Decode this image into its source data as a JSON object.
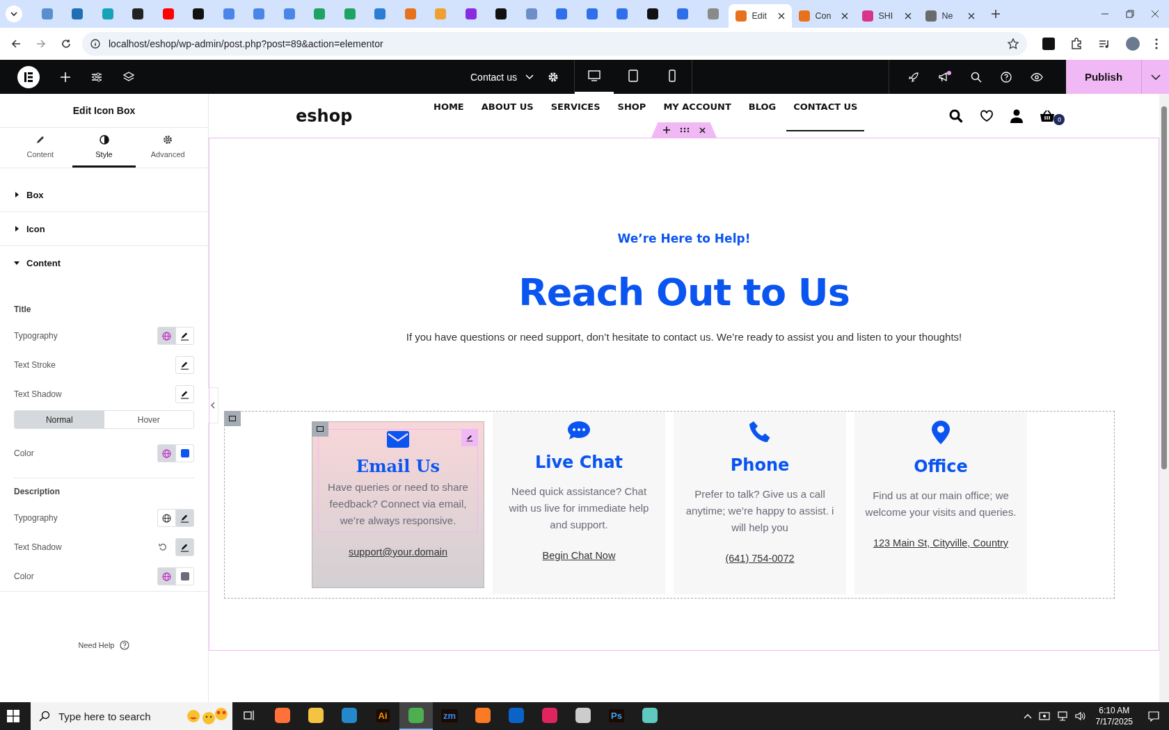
{
  "browser": {
    "favicon_tabs": [
      {
        "color": "#5a8ed1"
      },
      {
        "color": "#1f6fb5"
      },
      {
        "color": "#16a3b8"
      },
      {
        "color": "#222222"
      },
      {
        "color": "#ff0000"
      },
      {
        "color": "#111111"
      },
      {
        "color": "#4a86e8"
      },
      {
        "color": "#4a86e8"
      },
      {
        "color": "#4a86e8"
      },
      {
        "color": "#1ea362"
      },
      {
        "color": "#1ea362"
      },
      {
        "color": "#2b7cd3"
      },
      {
        "color": "#e8721c"
      },
      {
        "color": "#f0a030"
      },
      {
        "color": "#8a2be2"
      },
      {
        "color": "#111111"
      },
      {
        "color": "#6d8fc7"
      },
      {
        "color": "#2f6fea"
      },
      {
        "color": "#2f6fea"
      },
      {
        "color": "#2f6fea"
      },
      {
        "color": "#111111"
      },
      {
        "color": "#2f6fea"
      },
      {
        "color": "#8a8a8a"
      }
    ],
    "tabs": [
      {
        "label": "Edit",
        "selected": true,
        "color": "#e8721c"
      },
      {
        "label": "Con",
        "selected": false,
        "color": "#e8721c"
      },
      {
        "label": "SHI",
        "selected": false,
        "color": "#d9338a"
      },
      {
        "label": "Ne",
        "selected": false,
        "color": "#6b6b6b"
      }
    ],
    "url": "localhost/eshop/wp-admin/post.php?post=89&action=elementor"
  },
  "editor_bar": {
    "page_title": "Contact us",
    "devices": [
      {
        "kind": "desktop",
        "selected": true
      },
      {
        "kind": "tablet",
        "selected": false
      },
      {
        "kind": "mobile",
        "selected": false
      }
    ],
    "publish": "Publish"
  },
  "panel": {
    "title": "Edit Icon Box",
    "tabs": [
      {
        "label": "Content",
        "kind": "pencil",
        "selected": false
      },
      {
        "label": "Style",
        "kind": "contrast",
        "selected": true
      },
      {
        "label": "Advanced",
        "kind": "gear",
        "selected": false
      }
    ],
    "sections": [
      {
        "label": "Box",
        "expanded": false
      },
      {
        "label": "Icon",
        "expanded": false
      },
      {
        "label": "Content",
        "expanded": true,
        "groups": [
          {
            "title": "Title",
            "controls": [
              {
                "label": "Typography",
                "kind": "global-edit",
                "global_on": true,
                "edit_on": false
              },
              {
                "label": "Text Stroke",
                "kind": "edit",
                "edit_on": false
              },
              {
                "label": "Text Shadow",
                "kind": "edit",
                "edit_on": false
              },
              {
                "kind": "toggle",
                "options": [
                  {
                    "label": "Normal",
                    "selected": true
                  },
                  {
                    "label": "Hover",
                    "selected": false
                  }
                ]
              },
              {
                "label": "Color",
                "kind": "color",
                "global_on": true,
                "color": "#0a55f0"
              }
            ]
          },
          {
            "title": "Description",
            "controls": [
              {
                "label": "Typography",
                "kind": "global-edit",
                "global_on": false,
                "edit_on": true
              },
              {
                "label": "Text Shadow",
                "kind": "reset-edit",
                "edit_on": true
              },
              {
                "label": "Color",
                "kind": "color",
                "global_on": true,
                "color": "#6b6b7a"
              }
            ]
          }
        ]
      }
    ],
    "help": "Need Help"
  },
  "page": {
    "logo": "eshop",
    "nav": [
      {
        "label": "HOME",
        "selected": false
      },
      {
        "label": "ABOUT US",
        "selected": false
      },
      {
        "label": "SERVICES",
        "selected": false
      },
      {
        "label": "SHOP",
        "selected": false
      },
      {
        "label": "MY ACCOUNT",
        "selected": false
      },
      {
        "label": "BLOG",
        "selected": false
      },
      {
        "label": "CONTACT US",
        "selected": true
      }
    ],
    "cart_count": "0",
    "kicker": "We’re Here to Help!",
    "heading": "Reach Out to Us",
    "intro": "If you have questions or need support, don’t hesitate to contact us. We’re ready to assist you and listen to your thoughts!",
    "cards": [
      {
        "kind": "envelope",
        "title": "Email Us",
        "text": "Have queries or need to share feedback? Connect via email, we’re always responsive.",
        "link": "support@your.domain",
        "selected": true
      },
      {
        "kind": "chat",
        "title": "Live Chat",
        "text": "Need quick assistance? Chat with us live for immediate help and support.",
        "link": "Begin Chat Now",
        "selected": false
      },
      {
        "kind": "phone",
        "title": "Phone",
        "text": "Prefer to talk? Give us a call anytime; we’re happy to assist. i will help you",
        "link": "(641) 754-0072",
        "selected": false
      },
      {
        "kind": "pin",
        "title": "Office",
        "text": "Find us at our main office; we welcome your visits and queries.",
        "link": "123 Main St, Cityville, Country",
        "selected": false
      }
    ]
  },
  "taskbar": {
    "search": "Type here to search",
    "apps": [
      {
        "kind": "taskview",
        "selected": false
      },
      {
        "kind": "app",
        "color": "#ff7139",
        "selected": false
      },
      {
        "kind": "app",
        "color": "#f5c342",
        "selected": false
      },
      {
        "kind": "app",
        "color": "#2489ca",
        "selected": false
      },
      {
        "kind": "label",
        "label": "Ai",
        "color": "#ff9a00",
        "selected": false
      },
      {
        "kind": "app",
        "color": "#4caf50",
        "selected": true
      },
      {
        "kind": "label",
        "label": "zm",
        "color": "#2d8cff",
        "selected": false
      },
      {
        "kind": "app",
        "color": "#fb7a24",
        "selected": false
      },
      {
        "kind": "app",
        "color": "#0a64c8",
        "selected": false
      },
      {
        "kind": "app",
        "color": "#e0245e",
        "selected": false
      },
      {
        "kind": "app",
        "color": "#cccccc",
        "selected": false
      },
      {
        "kind": "label",
        "label": "Ps",
        "color": "#31a8ff",
        "selected": false
      },
      {
        "kind": "app",
        "color": "#5fc9c0",
        "selected": false
      }
    ],
    "time": "6:10 AM",
    "date": "7/17/2025"
  }
}
